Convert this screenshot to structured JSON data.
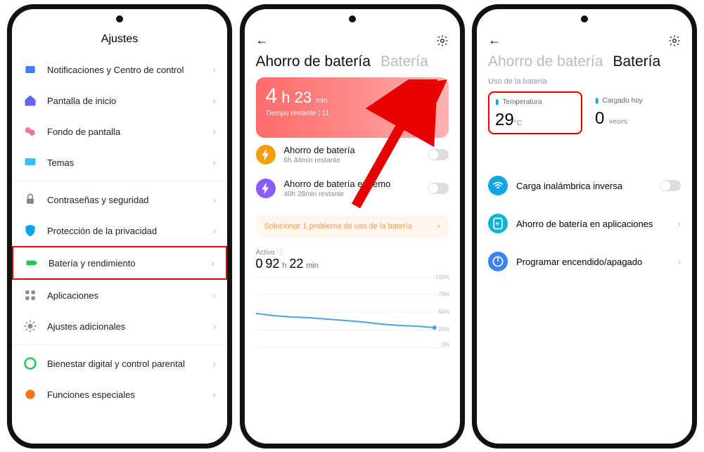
{
  "phone1": {
    "title": "Ajustes",
    "items": [
      {
        "label": "Notificaciones y Centro de control",
        "icon": "notification",
        "color": "#3b82f6"
      },
      {
        "label": "Pantalla de inicio",
        "icon": "home",
        "color": "#6366f1"
      },
      {
        "label": "Fondo de pantalla",
        "icon": "wallpaper",
        "color": "#ec4899"
      },
      {
        "label": "Temas",
        "icon": "theme",
        "color": "#38bdf8"
      }
    ],
    "items2": [
      {
        "label": "Contraseñas y seguridad",
        "icon": "lock",
        "color": "#888"
      },
      {
        "label": "Protección de la privacidad",
        "icon": "shield",
        "color": "#0ea5e9"
      },
      {
        "label": "Batería y rendimiento",
        "icon": "battery",
        "color": "#22c55e",
        "highlight": true
      },
      {
        "label": "Aplicaciones",
        "icon": "apps",
        "color": "#888"
      },
      {
        "label": "Ajustes adicionales",
        "icon": "gear",
        "color": "#888"
      }
    ],
    "items3": [
      {
        "label": "Bienestar digital y control parental",
        "icon": "wellbeing",
        "color": "#22c55e"
      },
      {
        "label": "Funciones especiales",
        "icon": "special",
        "color": "#f97316"
      }
    ]
  },
  "phone2": {
    "tabs": {
      "a": "Ahorro de batería",
      "b": "Batería"
    },
    "active_tab": "a",
    "remaining_h": "4",
    "remaining_m": "23",
    "remaining_unit": "min",
    "remaining_sub": "Tiempo restante | 11",
    "modes": [
      {
        "title": "Ahorro de batería",
        "sub": "6h 44min restante",
        "color": "#f59e0b",
        "icon": "bolt"
      },
      {
        "title": "Ahorro de batería extremo",
        "sub": "40h 28min restante",
        "color": "#8b5cf6",
        "icon": "bolt"
      }
    ],
    "banner": "Solucionar 1 problema de uso de la batería",
    "active_label": "Activo",
    "active_time": "92 h 22 min",
    "graph_labels": [
      "100%",
      "75%",
      "50%",
      "25%",
      "0%"
    ]
  },
  "phone3": {
    "tabs": {
      "a": "Ahorro de batería",
      "b": "Batería"
    },
    "active_tab": "b",
    "section": "Uso de la batería",
    "temp_label": "Temperatura",
    "temp_value": "29",
    "temp_unit": "°C",
    "charged_label": "Cargado hoy",
    "charged_value": "0",
    "charged_unit": "veces",
    "rows": [
      {
        "label": "Carga inalámbrica inversa",
        "color": "#0ea5e9",
        "toggle": true
      },
      {
        "label": "Ahorro de batería en aplicaciones",
        "color": "#06b6d4"
      },
      {
        "label": "Programar encendido/apagado",
        "color": "#3b82f6"
      }
    ]
  },
  "chart_data": {
    "type": "line",
    "title": "Activo",
    "ylabel": "%",
    "ylim": [
      0,
      100
    ],
    "x": [
      0,
      1,
      2,
      3,
      4,
      5,
      6,
      7,
      8,
      9,
      10
    ],
    "values": [
      48,
      45,
      43,
      42,
      40,
      38,
      36,
      33,
      31,
      30,
      28
    ]
  }
}
